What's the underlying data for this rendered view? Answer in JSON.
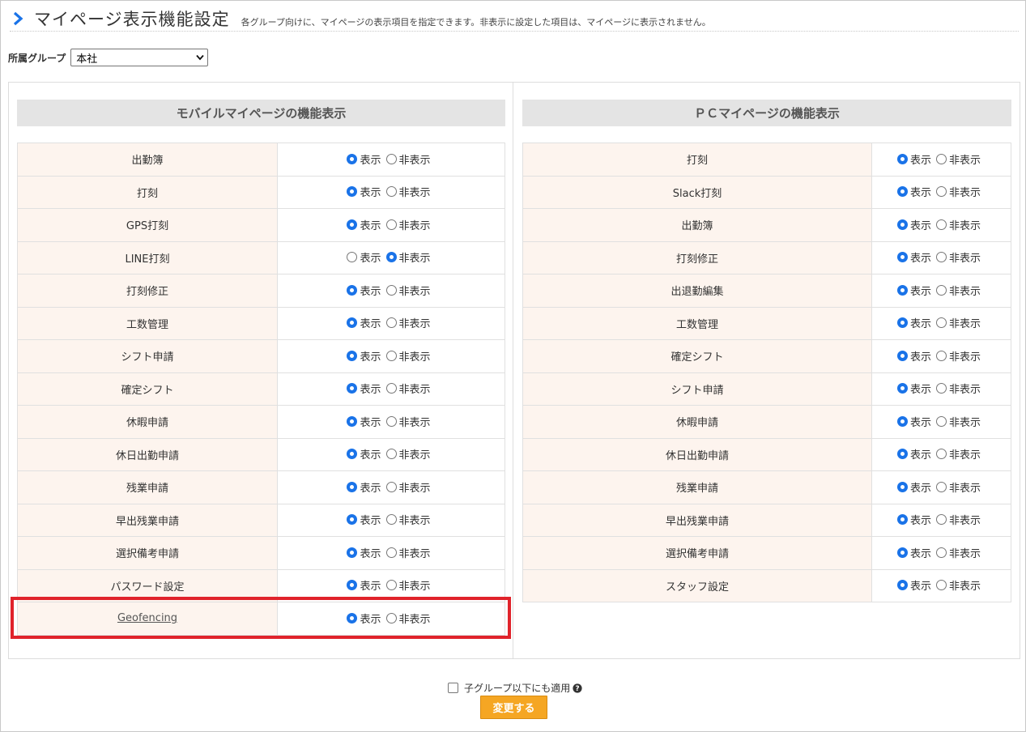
{
  "header": {
    "title": "マイページ表示機能設定",
    "description": "各グループ向けに、マイページの表示項目を指定できます。非表示に設定した項目は、マイページに表示されません。"
  },
  "group": {
    "label": "所属グループ",
    "selected": "本社"
  },
  "options": {
    "show": "表示",
    "hide": "非表示"
  },
  "mobile": {
    "title": "モバイルマイページの機能表示",
    "items": [
      {
        "label": "出勤簿",
        "value": "show"
      },
      {
        "label": "打刻",
        "value": "show"
      },
      {
        "label": "GPS打刻",
        "value": "show"
      },
      {
        "label": "LINE打刻",
        "value": "hide"
      },
      {
        "label": "打刻修正",
        "value": "show"
      },
      {
        "label": "工数管理",
        "value": "show"
      },
      {
        "label": "シフト申請",
        "value": "show"
      },
      {
        "label": "確定シフト",
        "value": "show"
      },
      {
        "label": "休暇申請",
        "value": "show"
      },
      {
        "label": "休日出勤申請",
        "value": "show"
      },
      {
        "label": "残業申請",
        "value": "show"
      },
      {
        "label": "早出残業申請",
        "value": "show"
      },
      {
        "label": "選択備考申請",
        "value": "show"
      },
      {
        "label": "パスワード設定",
        "value": "show"
      },
      {
        "label": "Geofencing",
        "value": "show",
        "link": true
      }
    ]
  },
  "pc": {
    "title": "ＰＣマイページの機能表示",
    "items": [
      {
        "label": "打刻",
        "value": "show"
      },
      {
        "label": "Slack打刻",
        "value": "show"
      },
      {
        "label": "出勤簿",
        "value": "show"
      },
      {
        "label": "打刻修正",
        "value": "show"
      },
      {
        "label": "出退勤編集",
        "value": "show"
      },
      {
        "label": "工数管理",
        "value": "show"
      },
      {
        "label": "確定シフト",
        "value": "show"
      },
      {
        "label": "シフト申請",
        "value": "show"
      },
      {
        "label": "休暇申請",
        "value": "show"
      },
      {
        "label": "休日出勤申請",
        "value": "show"
      },
      {
        "label": "残業申請",
        "value": "show"
      },
      {
        "label": "早出残業申請",
        "value": "show"
      },
      {
        "label": "選択備考申請",
        "value": "show"
      },
      {
        "label": "スタッフ設定",
        "value": "show"
      }
    ]
  },
  "footer": {
    "apply_child_label": "子グループ以下にも適用",
    "submit_label": "変更する"
  },
  "colors": {
    "accent": "#1a73e8",
    "highlight": "#e0232b",
    "button": "#f5a623",
    "label_cell": "#fdf4ee",
    "section_header": "#e4e4e4"
  },
  "icons": [
    "chevron-right-icon",
    "select-arrow-icon",
    "help-icon"
  ]
}
